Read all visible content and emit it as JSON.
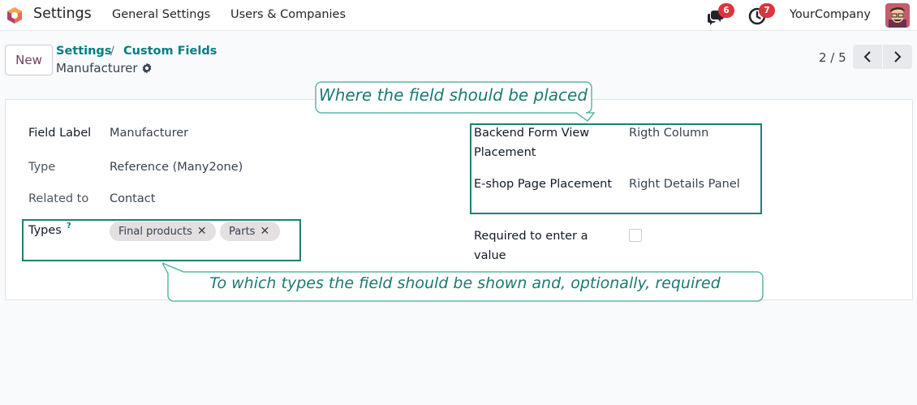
{
  "navbar": {
    "app_name": "Settings",
    "menu": [
      "General Settings",
      "Users & Companies"
    ],
    "messages_badge": "6",
    "activities_badge": "7",
    "company": "YourCompany",
    "icons": [
      "odoo-logo-icon",
      "chat-icon",
      "clock-icon",
      "avatar"
    ]
  },
  "control_panel": {
    "new_label": "New",
    "breadcrumb": [
      "Settings",
      "Custom Fields"
    ],
    "breadcrumb_separator": "/",
    "record_name": "Manufacturer",
    "pager": "2 / 5"
  },
  "form": {
    "field_label": {
      "label": "Field Label",
      "value": "Manufacturer"
    },
    "type": {
      "label": "Type",
      "value": "Reference (Many2one)"
    },
    "related_to": {
      "label": "Related to",
      "value": "Contact"
    },
    "types": {
      "label": "Types",
      "help": "?",
      "tags": [
        "Final products",
        "Parts"
      ],
      "remove": "✕"
    },
    "backend_placement": {
      "label": "Backend Form View Placement",
      "value": "Rigth Column"
    },
    "eshop_placement": {
      "label": "E-shop Page Placement",
      "value": "Right Details Panel"
    },
    "required": {
      "label": "Required to enter a value",
      "checked": false
    }
  },
  "annotations": {
    "top": "Where the field should be placed",
    "bottom": "To which types the field should be shown and, optionally, required",
    "color": "#1f7f75"
  },
  "colors": {
    "accent": "#017e84",
    "brand": "#71405f",
    "badge": "#d9363e",
    "tag_bg": "#e4dfe0"
  }
}
